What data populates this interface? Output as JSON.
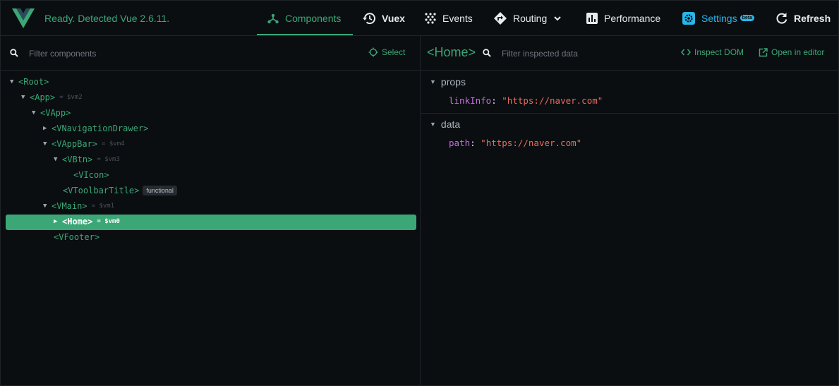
{
  "header": {
    "status": "Ready. Detected Vue 2.6.11.",
    "nav": [
      {
        "label": "Components",
        "icon": "components-icon"
      },
      {
        "label": "Vuex",
        "icon": "history-icon"
      },
      {
        "label": "Events",
        "icon": "events-icon"
      },
      {
        "label": "Routing",
        "icon": "routing-icon"
      },
      {
        "label": "Performance",
        "icon": "performance-icon"
      },
      {
        "label": "Settings",
        "icon": "settings-icon",
        "badge": "beta"
      },
      {
        "label": "Refresh",
        "icon": "refresh-icon"
      }
    ]
  },
  "components_pane": {
    "filter_placeholder": "Filter components",
    "select_label": "Select",
    "tree": [
      {
        "name": "Root",
        "expanded": true
      },
      {
        "name": "App",
        "expanded": true,
        "vm": "= $vm2"
      },
      {
        "name": "VApp",
        "expanded": true
      },
      {
        "name": "VNavigationDrawer",
        "expanded": false
      },
      {
        "name": "VAppBar",
        "expanded": true,
        "vm": "= $vm4"
      },
      {
        "name": "VBtn",
        "expanded": true,
        "vm": "= $vm3"
      },
      {
        "name": "VIcon"
      },
      {
        "name": "VToolbarTitle",
        "badge": "functional"
      },
      {
        "name": "VMain",
        "expanded": true,
        "vm": "= $vm1"
      },
      {
        "name": "Home",
        "expanded": false,
        "vm": "= $vm0",
        "selected": true
      },
      {
        "name": "VFooter"
      }
    ]
  },
  "inspector": {
    "component_name": "Home",
    "filter_placeholder": "Filter inspected data",
    "inspect_dom_label": "Inspect DOM",
    "open_editor_label": "Open in editor",
    "sections": [
      {
        "title": "props",
        "rows": [
          {
            "key": "linkInfo",
            "value": "\"https://naver.com\""
          }
        ]
      },
      {
        "title": "data",
        "rows": [
          {
            "key": "path",
            "value": "\"https://naver.com\""
          }
        ]
      }
    ]
  },
  "colors": {
    "accent": "#3ba776",
    "settings": "#29b6e8",
    "background": "#0b0e11",
    "key": "#c76ee0",
    "string": "#e86b5d"
  }
}
